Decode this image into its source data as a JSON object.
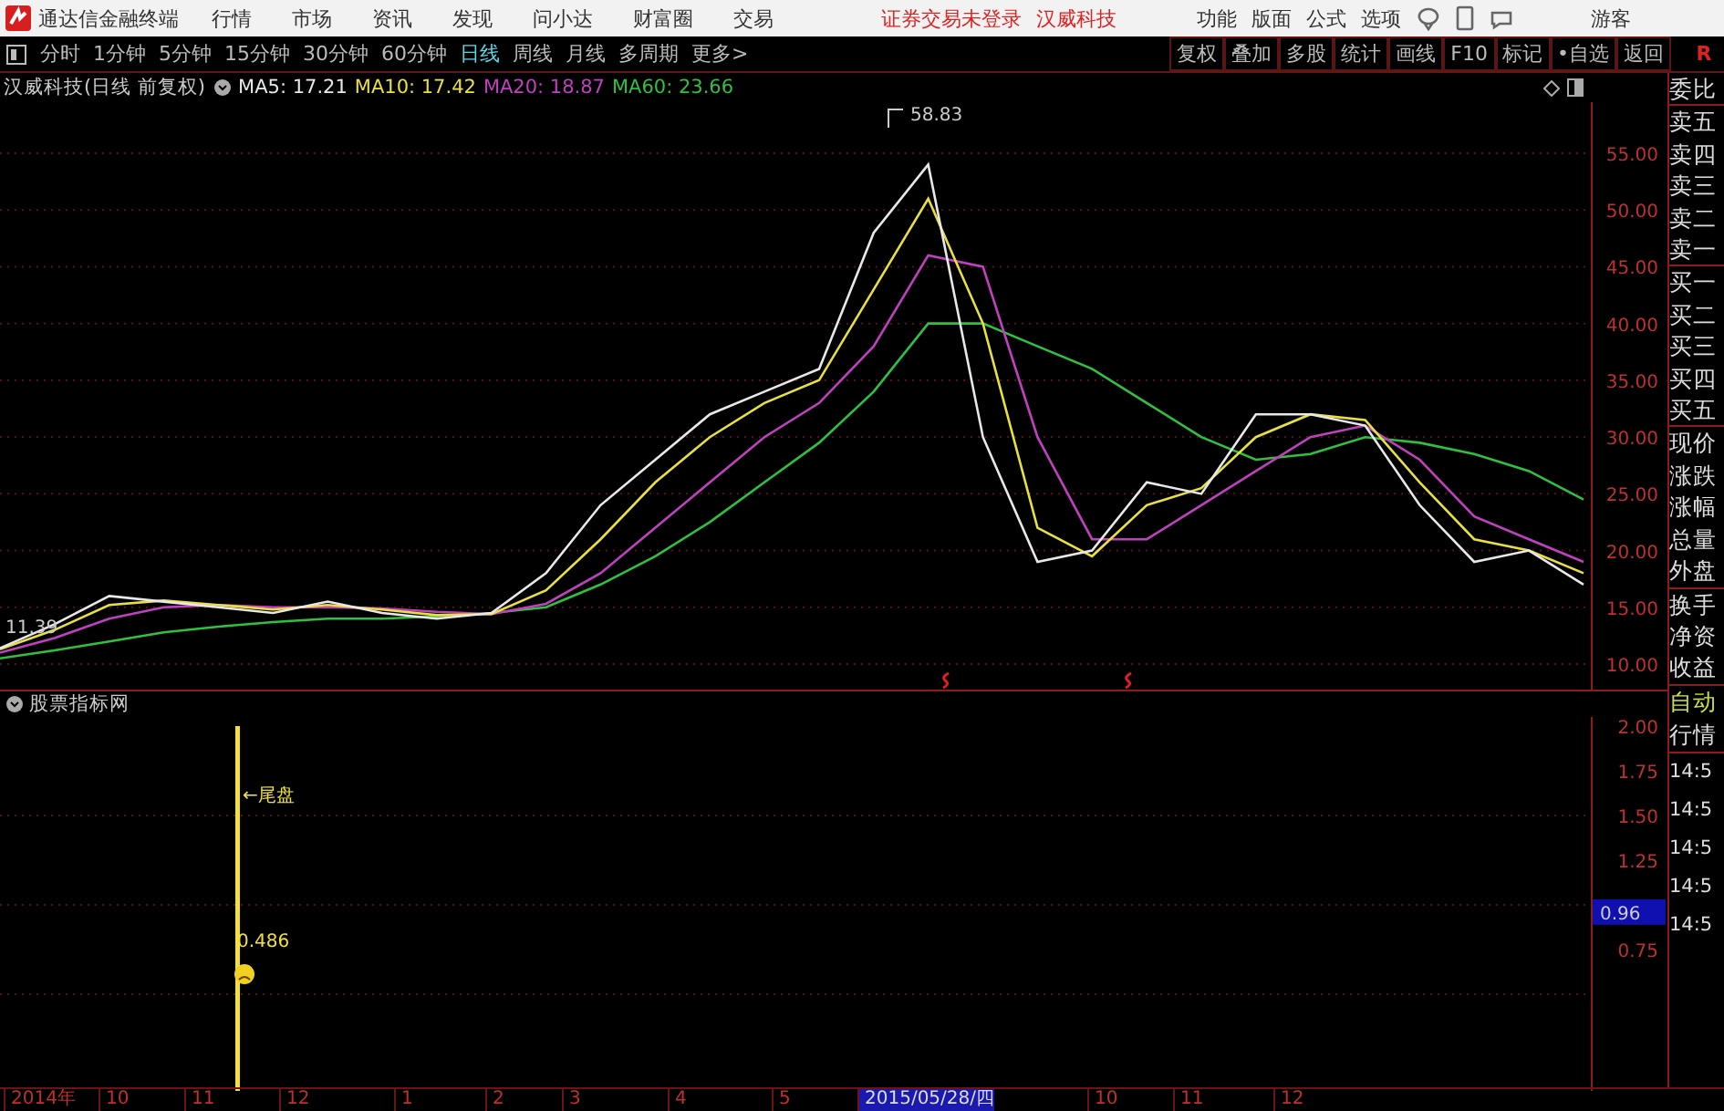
{
  "app_bar": {
    "title": "通达信金融终端",
    "menus": [
      "行情",
      "市场",
      "资讯",
      "发现",
      "问小达",
      "财富圈",
      "交易"
    ],
    "notice": [
      "证券交易未登录",
      "汉威科技"
    ],
    "tools": [
      "功能",
      "版面",
      "公式",
      "选项"
    ],
    "user": "游客"
  },
  "period_bar": {
    "periods": [
      {
        "label": "分时",
        "selected": false
      },
      {
        "label": "1分钟",
        "selected": false
      },
      {
        "label": "5分钟",
        "selected": false
      },
      {
        "label": "15分钟",
        "selected": false
      },
      {
        "label": "30分钟",
        "selected": false
      },
      {
        "label": "60分钟",
        "selected": false
      },
      {
        "label": "日线",
        "selected": true
      },
      {
        "label": "周线",
        "selected": false
      },
      {
        "label": "月线",
        "selected": false
      },
      {
        "label": "多周期",
        "selected": false
      },
      {
        "label": "更多>",
        "selected": false
      }
    ],
    "actions": [
      "复权",
      "叠加",
      "多股",
      "统计",
      "画线",
      "F10",
      "标记",
      "•自选",
      "返回"
    ],
    "flag": "R"
  },
  "price_panel": {
    "title": "汉威科技(日线 前复权)",
    "legend": [
      {
        "text": "MA5: 17.21",
        "color": "#e8e8e8"
      },
      {
        "text": "MA10: 17.42",
        "color": "#e8e040"
      },
      {
        "text": "MA20: 18.87",
        "color": "#c040c0"
      },
      {
        "text": "MA60: 23.66",
        "color": "#30c040"
      }
    ],
    "chart_data": {
      "type": "line",
      "grid": true,
      "ylim": [
        10,
        55
      ],
      "yticks": [
        {
          "value": 55,
          "label": "55.00"
        },
        {
          "value": 50,
          "label": "50.00"
        },
        {
          "value": 45,
          "label": "45.00"
        },
        {
          "value": 40,
          "label": "40.00"
        },
        {
          "value": 35,
          "label": "35.00"
        },
        {
          "value": 30,
          "label": "30.00"
        },
        {
          "value": 25,
          "label": "25.00"
        },
        {
          "value": 20,
          "label": "20.00"
        },
        {
          "value": 15,
          "label": "15.00"
        },
        {
          "value": 10,
          "label": "10.00"
        }
      ],
      "series": [
        {
          "color": "#30c040",
          "values": [
            10.5,
            11.2,
            12,
            12.8,
            13.3,
            13.7,
            14,
            14,
            14.2,
            14.5,
            15,
            17,
            19.5,
            22.5,
            26,
            29.5,
            34,
            40,
            40,
            38,
            36,
            33,
            30,
            28,
            28.5,
            30,
            29.5,
            28.5,
            27,
            24.5
          ]
        },
        {
          "color": "#c040c0",
          "values": [
            11,
            12.3,
            14,
            15,
            15.2,
            15,
            15,
            14.9,
            14.6,
            14.4,
            15.3,
            18,
            22,
            26,
            30,
            33,
            38,
            46,
            45,
            30,
            21,
            21,
            24,
            27,
            30,
            31,
            28,
            23,
            21,
            19
          ]
        },
        {
          "color": "#e8e040",
          "values": [
            11.3,
            13,
            15.2,
            15.6,
            15.2,
            14.8,
            15.2,
            14.8,
            14.3,
            14.4,
            16.5,
            21,
            26,
            30,
            33,
            35,
            43,
            51,
            40,
            22,
            19.5,
            24,
            25.5,
            30,
            32,
            31.5,
            26,
            21,
            20,
            18
          ]
        },
        {
          "color": "#e8e8e8",
          "values": [
            11.4,
            13.5,
            16,
            15.5,
            15,
            14.5,
            15.5,
            14.5,
            14,
            14.5,
            18,
            24,
            28,
            32,
            34,
            36,
            48,
            54,
            30,
            19,
            20,
            26,
            25,
            32,
            32,
            31,
            24,
            19,
            20,
            17
          ]
        }
      ],
      "annotations": [
        {
          "text": "58.83"
        },
        {
          "text": "11.39"
        }
      ]
    }
  },
  "indicator_panel": {
    "title": "股票指标网",
    "yticks": [
      "2.00",
      "1.75",
      "1.50",
      "1.25",
      "0.75"
    ],
    "cursor_value": "0.96",
    "signal_label": "←尾盘",
    "signal_value": "0.486"
  },
  "date_axis": [
    {
      "label": "2014年",
      "selected": false
    },
    {
      "label": "10",
      "selected": false
    },
    {
      "label": "11",
      "selected": false
    },
    {
      "label": "12",
      "selected": false
    },
    {
      "label": "1",
      "selected": false
    },
    {
      "label": "2",
      "selected": false
    },
    {
      "label": "3",
      "selected": false
    },
    {
      "label": "4",
      "selected": false
    },
    {
      "label": "5",
      "selected": false
    },
    {
      "label": "2015/05/28/四",
      "selected": true
    },
    {
      "label": "10",
      "selected": false
    },
    {
      "label": "11",
      "selected": false
    },
    {
      "label": "12",
      "selected": false
    }
  ],
  "quote_sidebar": [
    [
      "委比"
    ],
    [
      "卖五",
      "卖四",
      "卖三",
      "卖二",
      "卖一"
    ],
    [
      "买一",
      "买二",
      "买三",
      "买四",
      "买五"
    ],
    [
      "现价",
      "涨跌",
      "涨幅",
      "总量",
      "外盘"
    ],
    [
      "换手",
      "净资",
      "收益"
    ],
    [
      "自动",
      "行情"
    ],
    [
      "14:5",
      "14:5",
      "14:5",
      "14:5",
      "14:5"
    ]
  ]
}
